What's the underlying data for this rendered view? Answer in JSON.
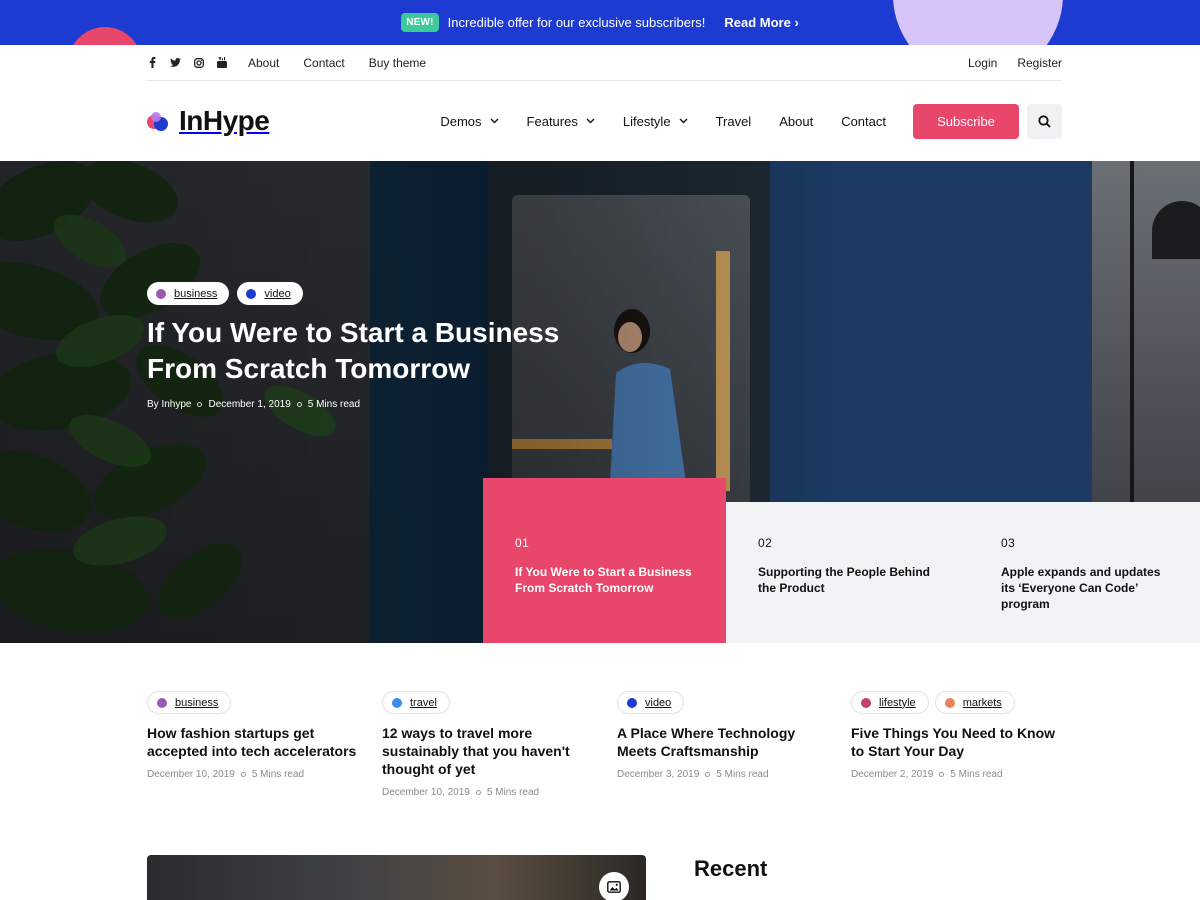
{
  "promo": {
    "badge": "NEW!",
    "text": "Incredible offer for our exclusive subscribers!",
    "link": "Read More ›",
    "bg_color": "#1d3bd1",
    "badge_color": "#3ec99a"
  },
  "topbar": {
    "social_icons": [
      "facebook-icon",
      "twitter-icon",
      "instagram-icon",
      "youtube-icon"
    ],
    "left_links": [
      "About",
      "Contact",
      "Buy theme"
    ],
    "right_links": [
      "Login",
      "Register"
    ]
  },
  "header": {
    "logo": "InHype",
    "nav": [
      {
        "label": "Demos",
        "has_dropdown": true
      },
      {
        "label": "Features",
        "has_dropdown": true
      },
      {
        "label": "Lifestyle",
        "has_dropdown": true
      },
      {
        "label": "Travel",
        "has_dropdown": false
      },
      {
        "label": "About",
        "has_dropdown": false
      },
      {
        "label": "Contact",
        "has_dropdown": false
      }
    ],
    "subscribe": "Subscribe",
    "accent_color": "#e8466b"
  },
  "hero": {
    "tags": [
      {
        "label": "business",
        "color": "#9b59b6"
      },
      {
        "label": "video",
        "color": "#1d3bd1"
      }
    ],
    "title_line1": "If You Were to Start a Business",
    "title_line2": "From Scratch Tomorrow",
    "author": "By Inhype",
    "date": "December 1, 2019",
    "read_time": "5 Mins read"
  },
  "slides": [
    {
      "num": "01",
      "title": "If You Were to Start a Business From Scratch Tomorrow",
      "active": true
    },
    {
      "num": "02",
      "title": "Supporting the People Behind the Product",
      "active": false
    },
    {
      "num": "03",
      "title": "Apple expands and updates its ‘Everyone Can Code’ program",
      "active": false
    }
  ],
  "posts": [
    {
      "tags": [
        {
          "label": "business",
          "color": "#9b59b6"
        }
      ],
      "title": "How fashion startups get accepted into tech accelerators",
      "date": "December 10, 2019",
      "read_time": "5 Mins read"
    },
    {
      "tags": [
        {
          "label": "travel",
          "color": "#3b8fe8"
        }
      ],
      "title": "12 ways to travel more sustainably that you haven't thought of yet",
      "date": "December 10, 2019",
      "read_time": "5 Mins read"
    },
    {
      "tags": [
        {
          "label": "video",
          "color": "#1d3bd1"
        }
      ],
      "title": "A Place Where Technology Meets Craftsmanship",
      "date": "December 3, 2019",
      "read_time": "5 Mins read"
    },
    {
      "tags": [
        {
          "label": "lifestyle",
          "color": "#c0406f"
        },
        {
          "label": "markets",
          "color": "#e8845a"
        }
      ],
      "title": "Five Things You Need to Know to Start Your Day",
      "date": "December 2, 2019",
      "read_time": "5 Mins read"
    }
  ],
  "recent": {
    "title": "Recent",
    "image_icon": "image-icon"
  }
}
